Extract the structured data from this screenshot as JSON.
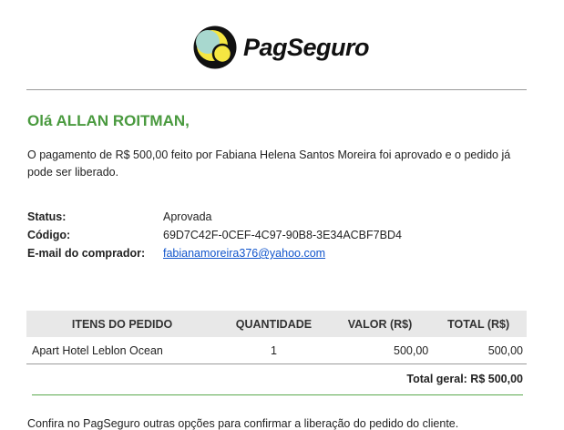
{
  "brand": {
    "name": "PagSeguro"
  },
  "greeting": "Olá ALLAN ROITMAN,",
  "message": "O pagamento de R$ 500,00 feito por Fabiana Helena Santos Moreira foi aprovado e o pedido já pode ser liberado.",
  "info": {
    "status_label": "Status:",
    "status_value": "Aprovada",
    "code_label": "Código:",
    "code_value": "69D7C42F-0CEF-4C97-90B8-3E34ACBF7BD4",
    "email_label": "E-mail do comprador:",
    "email_value": "fabianamoreira376@yahoo.com"
  },
  "table": {
    "headers": [
      "ITENS DO PEDIDO",
      "QUANTIDADE",
      "VALOR (R$)",
      "TOTAL (R$)"
    ],
    "rows": [
      {
        "item": "Apart Hotel Leblon Ocean",
        "qty": "1",
        "value": "500,00",
        "total": "500,00"
      }
    ]
  },
  "total_label": "Total geral: R$ 500,00",
  "footer": "Confira no PagSeguro outras opções para confirmar a liberação do pedido do cliente.",
  "colors": {
    "accent_green": "#4a9a3f",
    "link": "#1155cc",
    "logo_yellow": "#f5e642",
    "logo_teal": "#a8d8cf"
  }
}
